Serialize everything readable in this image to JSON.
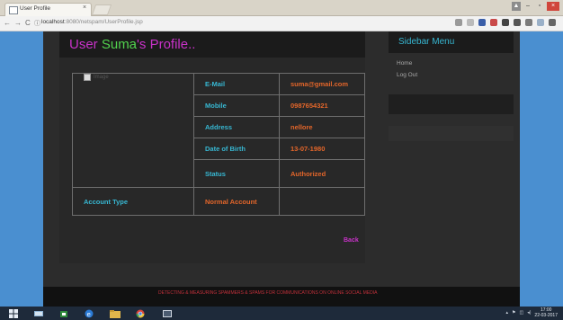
{
  "browser": {
    "tab_title": "User Profile",
    "tab_close": "×",
    "url_host": "localhost",
    "url_path": ":8080/netspam/UserProfile.jsp",
    "nav_back": "←",
    "nav_forward": "→",
    "nav_reload": "C",
    "info_icon": "ⓘ"
  },
  "window": {
    "minimize": "–",
    "maximize": "▫",
    "close": "×"
  },
  "page": {
    "title_prefix": "User ",
    "user_name": "Suma",
    "title_suffix": "'s Profile..",
    "image_alt": "Image",
    "fields": [
      {
        "label": "E-Mail",
        "value": "suma@gmail.com"
      },
      {
        "label": "Mobile",
        "value": "0987654321"
      },
      {
        "label": "Address",
        "value": "nellore"
      },
      {
        "label": "Date of Birth",
        "value": "13-07-1980"
      },
      {
        "label": "Status",
        "value": "Authorized"
      }
    ],
    "account_type_label": "Account Type",
    "account_type_value": "Normal Account",
    "back_link": "Back"
  },
  "sidebar": {
    "title": "Sidebar Menu",
    "items": [
      {
        "label": "Home"
      },
      {
        "label": "Log Out"
      }
    ]
  },
  "footer": {
    "text": "DETECTING & MEASURING SPAMMERS & SPAMS FOR COMMUNICATIONS ON ONLINE SOCIAL MEDIA"
  },
  "taskbar": {
    "time": "17:00",
    "date": "22-03-2017"
  },
  "colors": {
    "accent_magenta": "#c832c8",
    "accent_green": "#52d24e",
    "label_cyan": "#37b7d2",
    "value_orange": "#e4662a",
    "desktop_blue": "#4a8fd0"
  }
}
